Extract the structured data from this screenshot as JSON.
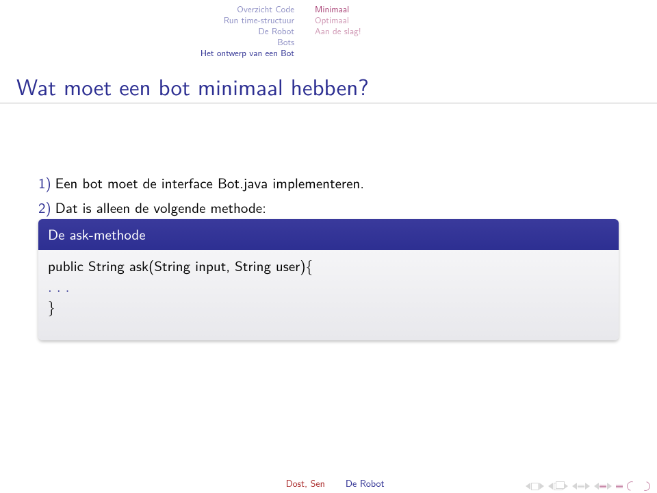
{
  "sections": {
    "left": [
      "Overzicht Code",
      "Run time-structuur",
      "De Robot",
      "Bots",
      "Het ontwerp van een Bot"
    ],
    "right": [
      "Minimaal",
      "Optimaal",
      "Aan de slag!"
    ]
  },
  "frame_title": "Wat moet een bot minimaal hebben?",
  "enumerate": [
    {
      "num": "1)",
      "text": "Een bot moet de interface Bot.java implementeren."
    },
    {
      "num": "2)",
      "text": "Dat is alleen de volgende methode:"
    }
  ],
  "block": {
    "title": "De ask-methode",
    "line1": "public String ask(String input, String user){",
    "dots": ". . .",
    "line2": "}"
  },
  "footer": {
    "author": "Dost, Sen",
    "title": "De Robot"
  }
}
